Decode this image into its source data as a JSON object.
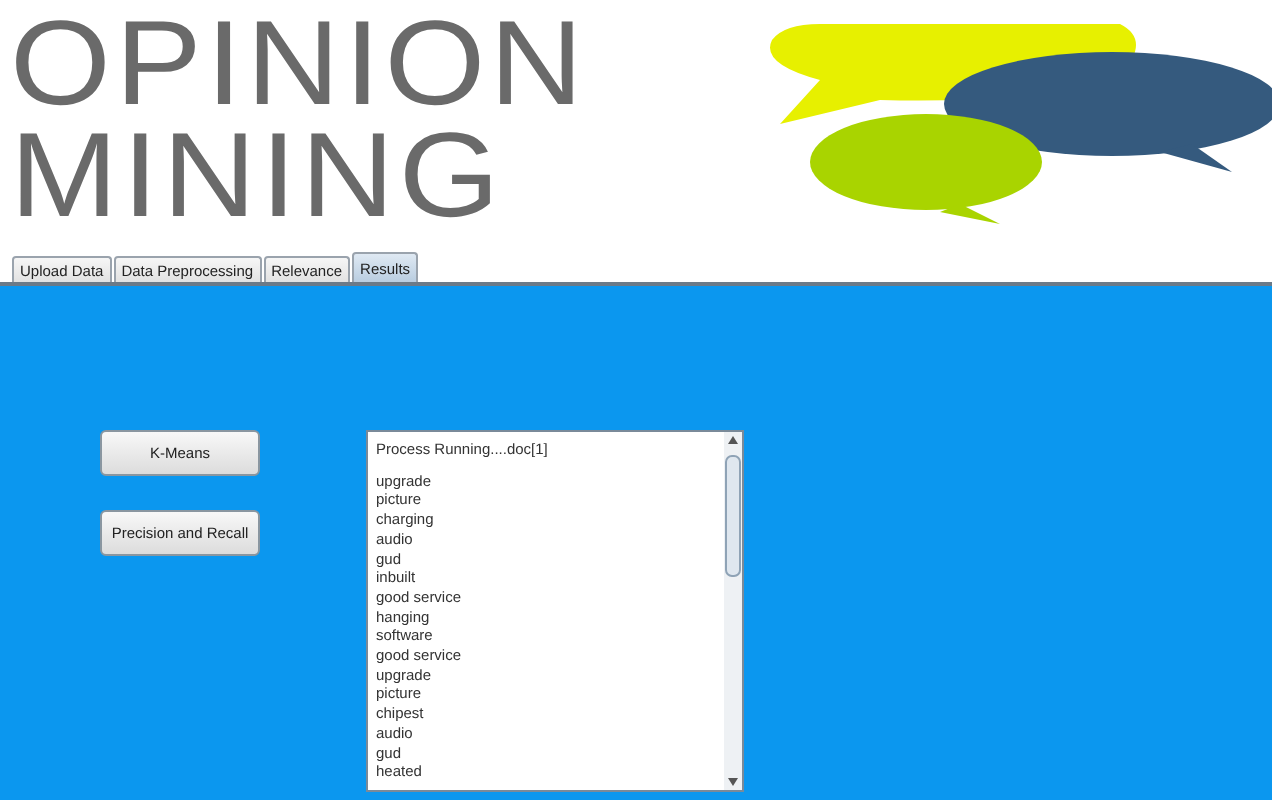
{
  "banner": {
    "title_lines": [
      "OPINION",
      "MINING"
    ]
  },
  "tabs": [
    {
      "label": "Upload Data",
      "selected": false
    },
    {
      "label": "Data Preprocessing",
      "selected": false
    },
    {
      "label": "Relevance",
      "selected": false
    },
    {
      "label": "Results",
      "selected": true
    }
  ],
  "buttons": [
    "K-Means",
    "Precision and Recall"
  ],
  "output": {
    "header": "Process Running....doc[1]",
    "lines": [
      "upgrade",
      "picture",
      "charging",
      "audio",
      "gud",
      "inbuilt",
      "good service",
      "hanging",
      "software",
      "good service",
      "upgrade",
      "picture",
      "chipest",
      "audio",
      "gud",
      "heated"
    ]
  }
}
